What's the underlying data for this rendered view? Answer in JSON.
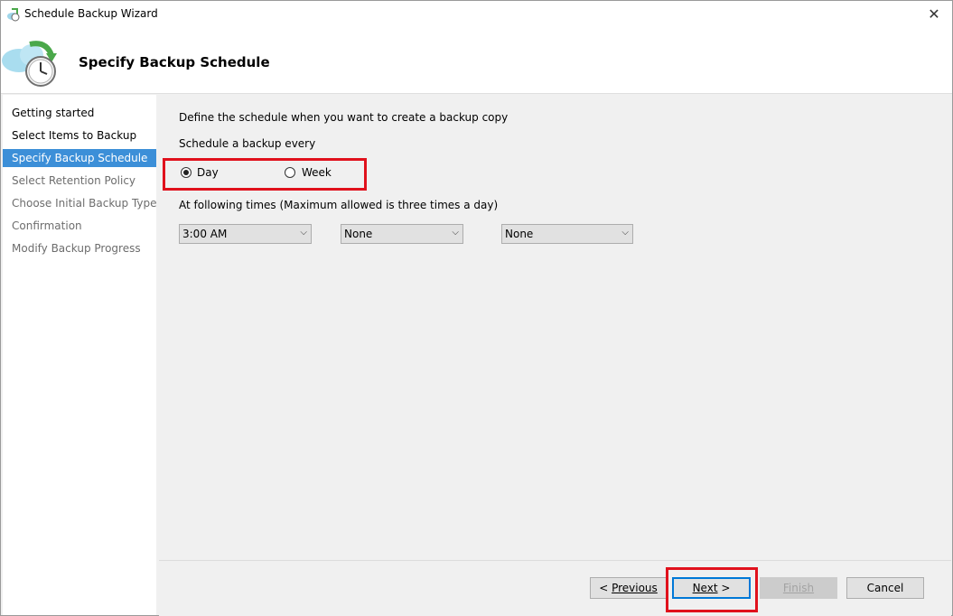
{
  "window": {
    "title": "Schedule Backup Wizard",
    "close_glyph": "✕"
  },
  "header": {
    "title": "Specify Backup Schedule",
    "icon": "backup-schedule-icon"
  },
  "nav": {
    "items": [
      {
        "label": "Getting started",
        "state": "done"
      },
      {
        "label": "Select Items to Backup",
        "state": "done"
      },
      {
        "label": "Specify Backup Schedule",
        "state": "active"
      },
      {
        "label": "Select Retention Policy",
        "state": "pending"
      },
      {
        "label": "Choose Initial Backup Type",
        "state": "pending"
      },
      {
        "label": "Confirmation",
        "state": "pending"
      },
      {
        "label": "Modify Backup Progress",
        "state": "pending"
      }
    ]
  },
  "main": {
    "description": "Define the schedule when you want to create a backup copy",
    "schedule_label": "Schedule a backup every",
    "frequency_options": [
      {
        "label": "Day",
        "selected": true
      },
      {
        "label": "Week",
        "selected": false
      }
    ],
    "times_label": "At following times (Maximum allowed is three times a day)",
    "time_selects": [
      {
        "value": "3:00 AM"
      },
      {
        "value": "None"
      },
      {
        "value": "None"
      }
    ]
  },
  "footer": {
    "previous": {
      "prefix": "< ",
      "label": "Previous"
    },
    "next": {
      "label": "Next",
      "suffix": " >"
    },
    "finish": {
      "label": "Finish",
      "disabled": true
    },
    "cancel": {
      "label": "Cancel"
    }
  },
  "colors": {
    "accent": "#3c8fd8",
    "highlight": "#e0111c",
    "focus": "#0078d7"
  }
}
